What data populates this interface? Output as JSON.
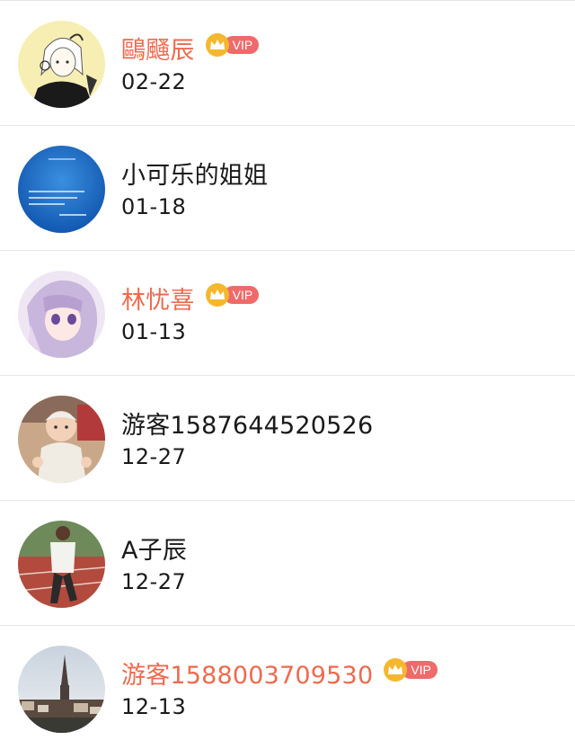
{
  "colors": {
    "vip_name": "#ee6a4f",
    "normal_name": "#1a1a1a",
    "vip_pill": "#ef6a6a",
    "vip_crown": "#f5b72e",
    "divider": "#e6e6e6"
  },
  "users": [
    {
      "name": "鷗颾辰",
      "date": "02-22",
      "vip": true,
      "vip_label": "VIP",
      "avatar_icon": "anime-girl-avatar-icon"
    },
    {
      "name": "小可乐的姐姐",
      "date": "01-18",
      "vip": false,
      "avatar_icon": "blue-text-avatar-icon"
    },
    {
      "name": "林忧喜",
      "date": "01-13",
      "vip": true,
      "vip_label": "VIP",
      "avatar_icon": "anime-purple-hair-avatar-icon"
    },
    {
      "name": "游客1587644520526",
      "date": "12-27",
      "vip": false,
      "avatar_icon": "baby-photo-avatar-icon"
    },
    {
      "name": "A子辰",
      "date": "12-27",
      "vip": false,
      "avatar_icon": "running-track-avatar-icon"
    },
    {
      "name": "游客1588003709530",
      "date": "12-13",
      "vip": true,
      "vip_label": "VIP",
      "avatar_icon": "church-town-avatar-icon"
    }
  ]
}
